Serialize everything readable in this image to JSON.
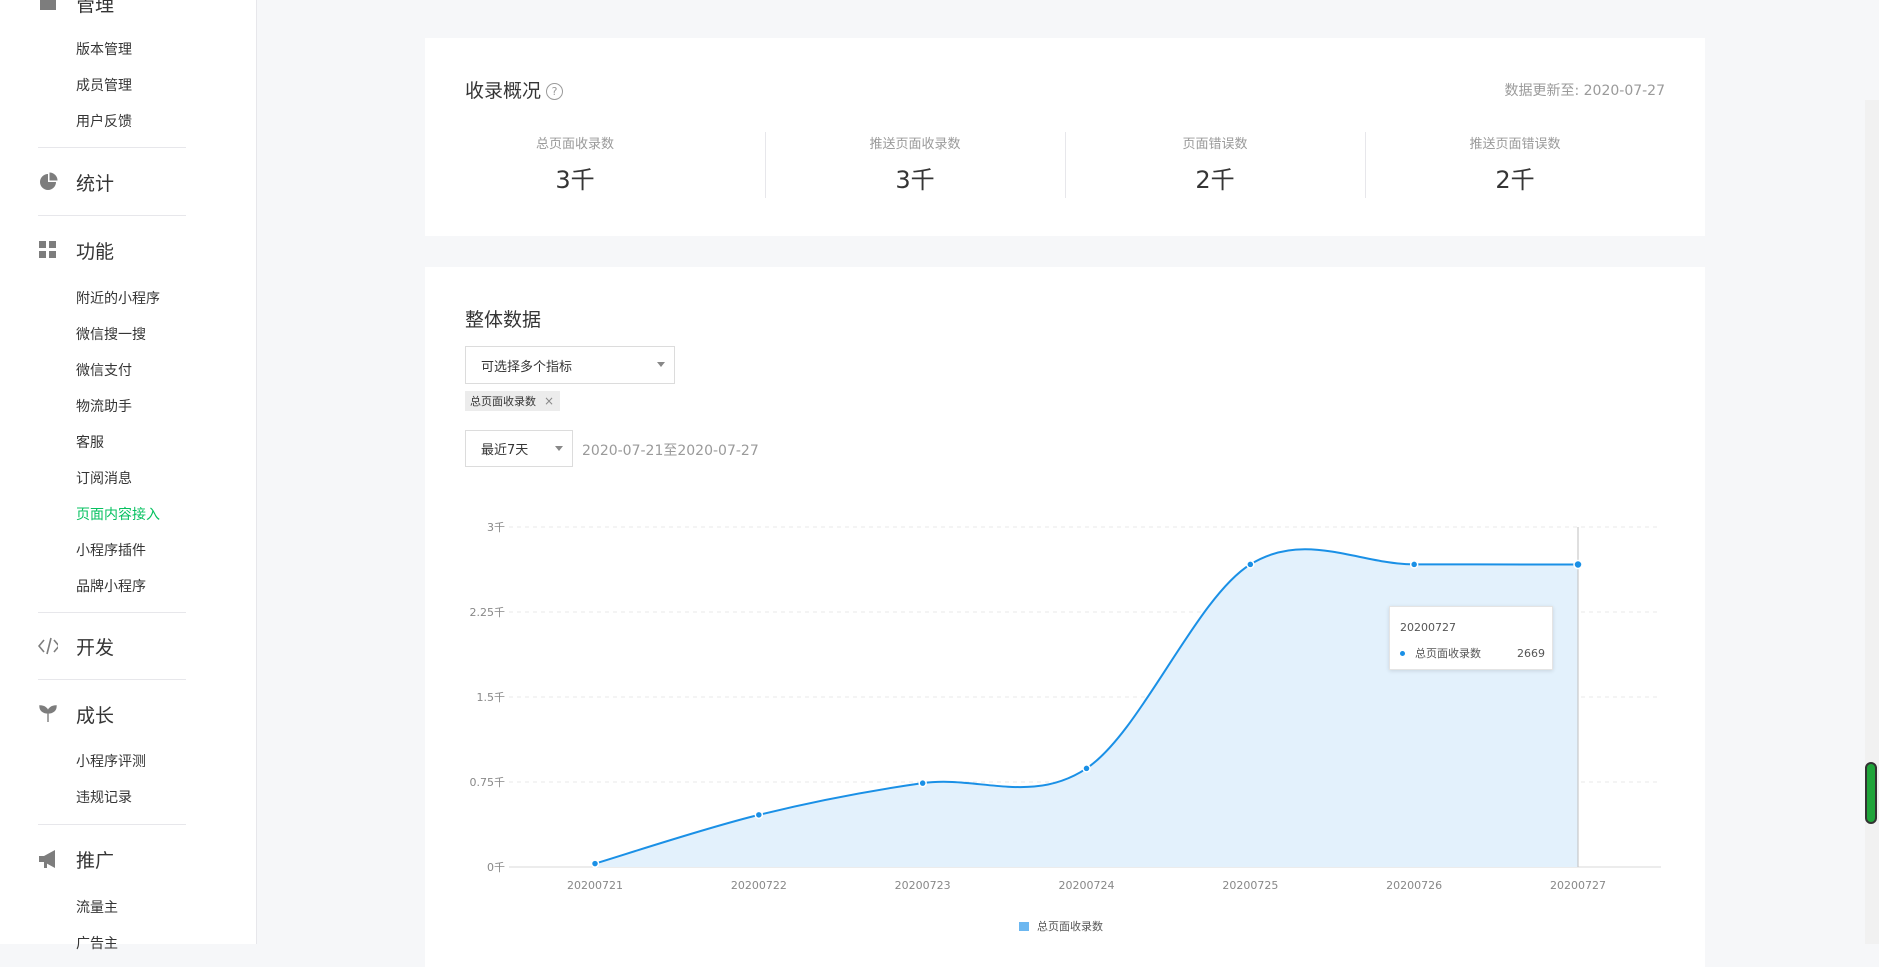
{
  "sidebar": {
    "sections": [
      {
        "label": "管理",
        "icon": "management-icon"
      },
      {
        "label": "统计",
        "icon": "pie-chart-icon"
      },
      {
        "label": "功能",
        "icon": "grid-icon"
      },
      {
        "label": "开发",
        "icon": "code-icon"
      },
      {
        "label": "成长",
        "icon": "sprout-icon"
      },
      {
        "label": "推广",
        "icon": "megaphone-icon"
      }
    ],
    "items": [
      {
        "label": "版本管理"
      },
      {
        "label": "成员管理"
      },
      {
        "label": "用户反馈"
      },
      {
        "label": "附近的小程序"
      },
      {
        "label": "微信搜一搜"
      },
      {
        "label": "微信支付"
      },
      {
        "label": "物流助手"
      },
      {
        "label": "客服"
      },
      {
        "label": "订阅消息"
      },
      {
        "label": "页面内容接入",
        "active": true
      },
      {
        "label": "小程序插件"
      },
      {
        "label": "品牌小程序"
      },
      {
        "label": "小程序评测"
      },
      {
        "label": "违规记录"
      },
      {
        "label": "流量主"
      },
      {
        "label": "广告主"
      }
    ]
  },
  "overview": {
    "title": "收录概况",
    "help_symbol": "?",
    "updated": "数据更新至: 2020-07-27",
    "stats": [
      {
        "label": "总页面收录数",
        "value": "3千"
      },
      {
        "label": "推送页面收录数",
        "value": "3千"
      },
      {
        "label": "页面错误数",
        "value": "2千"
      },
      {
        "label": "推送页面错误数",
        "value": "2千"
      }
    ]
  },
  "overall": {
    "title": "整体数据",
    "metric_select_placeholder": "可选择多个指标",
    "selected_tag": "总页面收录数",
    "tag_close": "×",
    "period_select": "最近7天",
    "date_range": "2020-07-21至2020-07-27"
  },
  "tooltip": {
    "date": "20200727",
    "series": "总页面收录数",
    "value": "2669"
  },
  "chart_data": {
    "type": "area",
    "x": [
      "20200721",
      "20200722",
      "20200723",
      "20200724",
      "20200725",
      "20200726",
      "20200727"
    ],
    "series": [
      {
        "name": "总页面收录数",
        "values": [
          30,
          460,
          740,
          870,
          2670,
          2670,
          2669
        ],
        "color": "#1a90e6"
      }
    ],
    "yticks": [
      "0千",
      "0.75千",
      "1.5千",
      "2.25千",
      "3千"
    ],
    "ylim": [
      0,
      3000
    ],
    "grid": true,
    "legend": "bottom-center"
  },
  "colors": {
    "accent": "#07c160",
    "series": "#1a90e6",
    "fill": "#e3f1fc"
  }
}
